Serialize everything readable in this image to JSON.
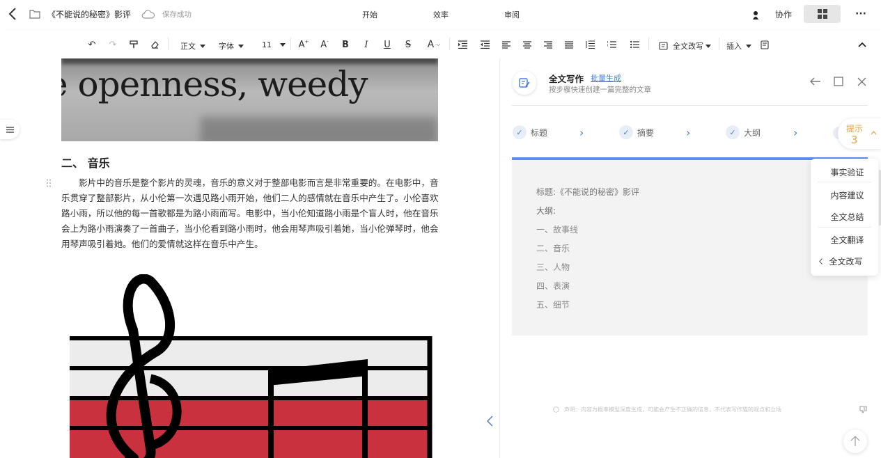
{
  "topbar": {
    "doc_title": "《不能说的秘密》影评",
    "save_status": "保存成功",
    "tabs": [
      "开始",
      "效率",
      "审阅"
    ],
    "collab": "协作"
  },
  "toolbar": {
    "style": "正文",
    "font": "字体",
    "size": "11",
    "rewrite": "全文改写",
    "insert": "插入"
  },
  "document": {
    "image_text": "e openness, weedy",
    "heading": "二、 音乐",
    "paragraph": "影片中的音乐是整个影片的灵魂，音乐的意义对于整部电影而言是非常重要的。在电影中，音乐贯穿了整部影片，从小伦第一次遇见路小雨开始，他们二人的感情就在音乐中产生了。小伦喜欢路小雨，所以他的每一首歌都是为路小雨而写。电影中，当小伦知道路小雨是个盲人时，他在音乐会上为路小雨演奏了一首曲子，当小伦看到路小雨时，他会用琴声吸引着她，当小伦弹琴时，他会用琴声吸引着她。他们的爱情就这样在音乐中产生。"
  },
  "panel": {
    "title": "全文写作",
    "batch_link": "批量生成",
    "subtitle": "按步骤快速创建一篇完整的文章",
    "steps": [
      "标题",
      "摘要",
      "大纲"
    ],
    "hint_label": "提示",
    "hint_count": "3",
    "outline_title": "标题:《不能说的秘密》影评",
    "outline_label": "大纲:",
    "outline_items": [
      "一、故事线",
      "二、音乐",
      "三、人物",
      "四、表演",
      "五、细节"
    ],
    "disclaimer": "声明：内容为概率模型深度生成，可能会产生不正确的信息，不代表写作猫的观点和立场",
    "menu": [
      "事实验证",
      "内容建议",
      "全文总结",
      "全文翻译",
      "全文改写"
    ]
  },
  "colors": {
    "accent": "#4a7fd6",
    "hint": "#e6a23c",
    "progress": "#5b8def"
  }
}
